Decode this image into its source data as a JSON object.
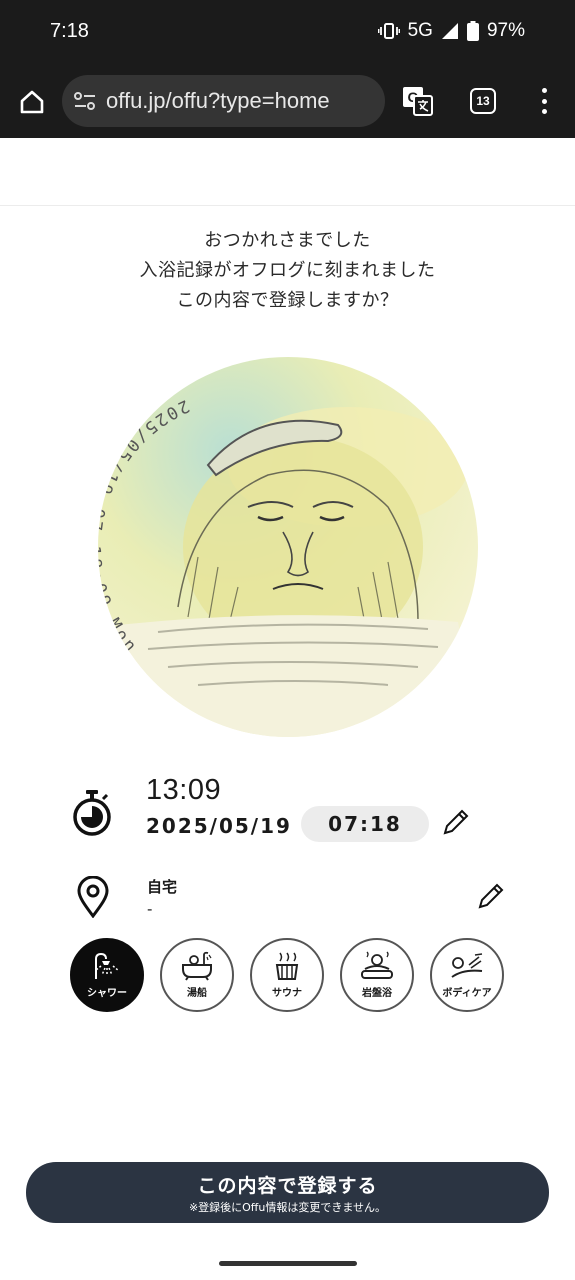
{
  "status_bar": {
    "time": "7:18",
    "network": "5G",
    "battery": "97%"
  },
  "browser": {
    "url": "offu.jp/offu?type=home",
    "tab_count": "13"
  },
  "message": {
    "line1": "おつかれさまでした",
    "line2": "入浴記録がオフログに刻まれました",
    "line3": "この内容で登録しますか？"
  },
  "photo": {
    "stamp": "2025/05/19 07:18:09 Mon"
  },
  "record": {
    "elapsed": "13:09",
    "date": "2025/05/19",
    "time": "07:18"
  },
  "place": {
    "name": "自宅",
    "sub": "-"
  },
  "categories": [
    {
      "label": "シャワー",
      "icon": "shower-icon",
      "active": true
    },
    {
      "label": "湯船",
      "icon": "bathtub-icon",
      "active": false
    },
    {
      "label": "サウナ",
      "icon": "sauna-icon",
      "active": false
    },
    {
      "label": "岩盤浴",
      "icon": "bedrock-bath-icon",
      "active": false
    },
    {
      "label": "ボディケア",
      "icon": "body-care-icon",
      "active": false
    }
  ],
  "submit": {
    "label": "この内容で登録する",
    "note": "※登録後にOffu情報は変更できません。"
  },
  "colors": {
    "accent_dark": "#2b3442",
    "active_category": "#0c0c0c",
    "pill_bg": "#ececec"
  }
}
